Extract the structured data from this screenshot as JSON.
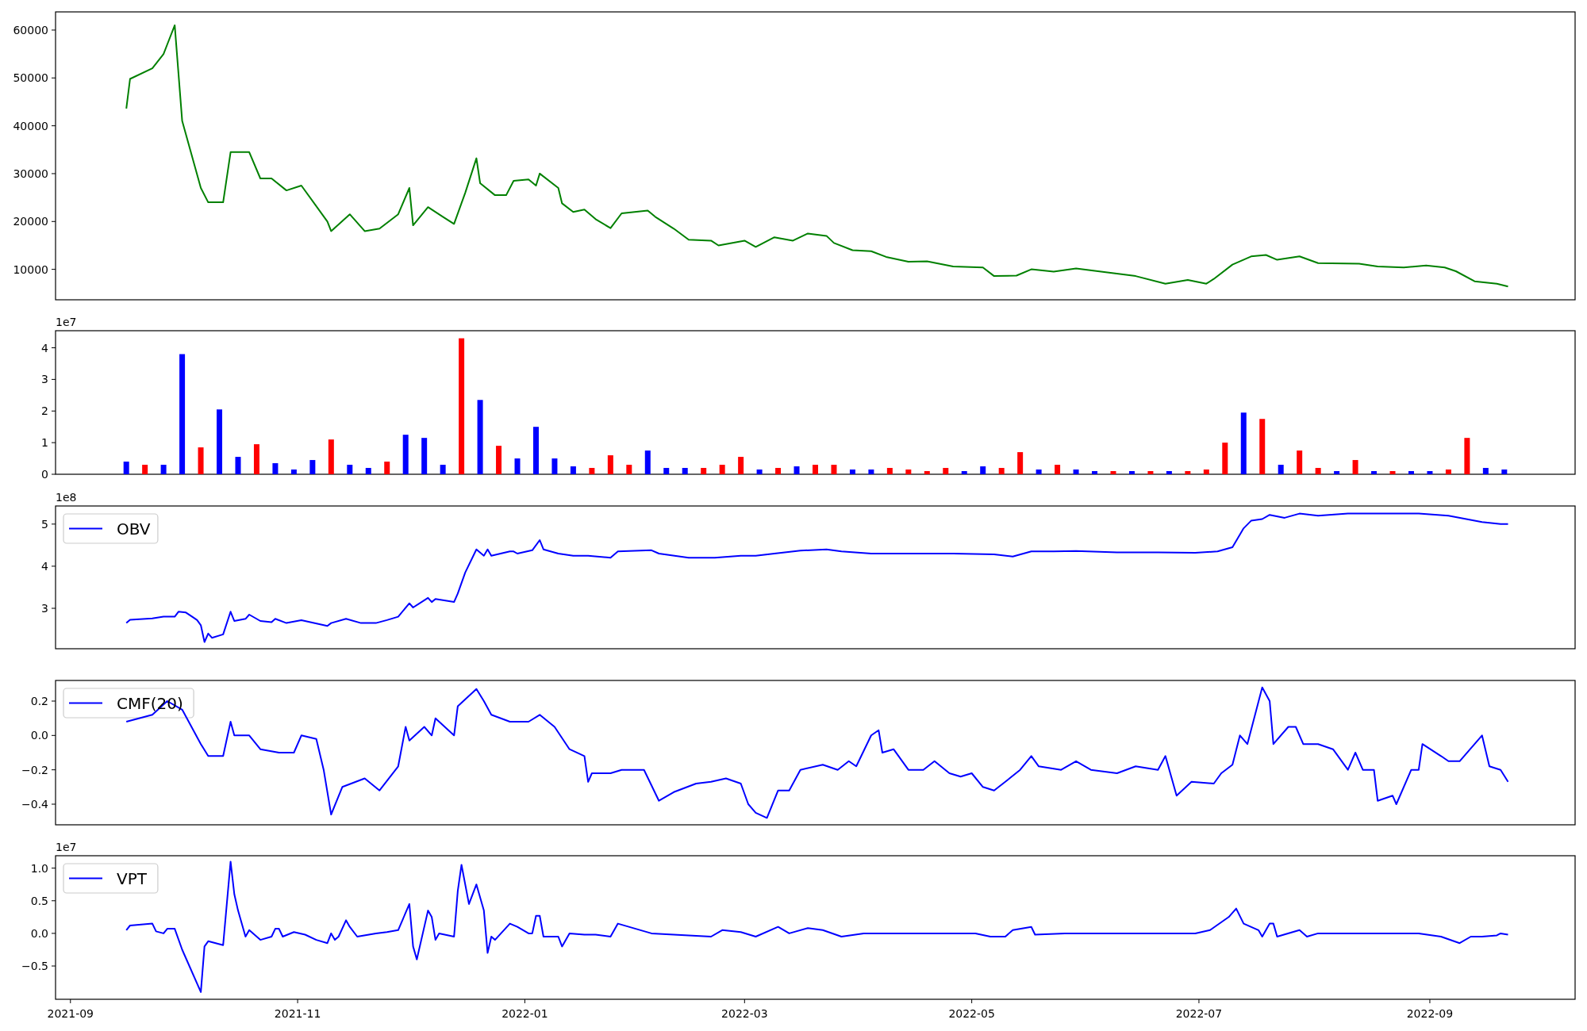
{
  "panels": [
    {
      "legend": false,
      "chart_data": {
        "type": "line",
        "xlim": [
          "2021-08-28",
          "2022-10-10"
        ],
        "ylim": [
          3640,
          63800
        ],
        "yticks": [
          10000,
          20000,
          30000,
          40000,
          50000,
          60000
        ],
        "x": [
          "2021-09-16",
          "2021-09-17",
          "2021-09-23",
          "2021-09-26",
          "2021-09-27",
          "2021-09-29",
          "2021-10-01",
          "2021-10-06",
          "2021-10-08",
          "2021-10-12",
          "2021-10-14",
          "2021-10-19",
          "2021-10-22",
          "2021-10-25",
          "2021-10-29",
          "2021-11-02",
          "2021-11-09",
          "2021-11-10",
          "2021-11-15",
          "2021-11-19",
          "2021-11-23",
          "2021-11-28",
          "2021-12-01",
          "2021-12-02",
          "2021-12-06",
          "2021-12-10",
          "2021-12-13",
          "2021-12-16",
          "2021-12-19",
          "2021-12-20",
          "2021-12-24",
          "2021-12-27",
          "2021-12-29",
          "2022-01-02",
          "2022-01-04",
          "2022-01-05",
          "2022-01-10",
          "2022-01-11",
          "2022-01-14",
          "2022-01-17",
          "2022-01-20",
          "2022-01-24",
          "2022-01-27",
          "2022-02-03",
          "2022-02-05",
          "2022-02-10",
          "2022-02-14",
          "2022-02-20",
          "2022-02-22",
          "2022-03-01",
          "2022-03-04",
          "2022-03-09",
          "2022-03-14",
          "2022-03-18",
          "2022-03-23",
          "2022-03-25",
          "2022-03-30",
          "2022-04-04",
          "2022-04-08",
          "2022-04-14",
          "2022-04-19",
          "2022-04-26",
          "2022-05-04",
          "2022-05-07",
          "2022-05-13",
          "2022-05-17",
          "2022-05-23",
          "2022-05-29",
          "2022-06-06",
          "2022-06-14",
          "2022-06-22",
          "2022-06-28",
          "2022-07-03",
          "2022-07-05",
          "2022-07-10",
          "2022-07-15",
          "2022-07-19",
          "2022-07-22",
          "2022-07-28",
          "2022-08-02",
          "2022-08-13",
          "2022-08-18",
          "2022-08-25",
          "2022-08-31",
          "2022-09-05",
          "2022-09-08",
          "2022-09-13",
          "2022-09-19",
          "2022-09-22"
        ],
        "series": [
          {
            "color": "#008000",
            "values": [
              43600,
              49800,
              52000,
              55000,
              57000,
              61000,
              41000,
              27000,
              24000,
              24000,
              34500,
              34500,
              29000,
              29000,
              26500,
              27500,
              20000,
              18000,
              21500,
              18000,
              18500,
              21500,
              27000,
              19200,
              23000,
              21000,
              19500,
              26000,
              33200,
              28000,
              25500,
              25500,
              28500,
              28800,
              27500,
              30000,
              27000,
              23800,
              22000,
              22500,
              20500,
              18600,
              21700,
              22300,
              21000,
              18500,
              16200,
              16000,
              15000,
              16000,
              14700,
              16700,
              16000,
              17500,
              17000,
              15500,
              14000,
              13800,
              12600,
              11600,
              11700,
              10600,
              10400,
              8600,
              8700,
              10000,
              9500,
              10200,
              9400,
              8600,
              7000,
              7800,
              7000,
              8000,
              11000,
              12700,
              13000,
              12000,
              12700,
              11300,
              11200,
              10600,
              10400,
              10800,
              10400,
              9600,
              7500,
              7000,
              6400
            ]
          }
        ]
      }
    },
    {
      "legend": false,
      "offset_label": "1e7",
      "chart_data": {
        "type": "bar",
        "xlim": [
          "2021-08-28",
          "2022-10-10"
        ],
        "ylim": [
          0,
          4.54
        ],
        "yticks": [
          {
            "value": 0,
            "label": "0"
          },
          {
            "value": 1,
            "label": "1"
          },
          {
            "value": 2,
            "label": "2"
          },
          {
            "value": 3,
            "label": "3"
          },
          {
            "value": 4,
            "label": "4"
          }
        ],
        "x": [
          "2021-09-16",
          "2021-09-21",
          "2021-09-26",
          "2021-10-01",
          "2021-10-06",
          "2021-10-11",
          "2021-10-16",
          "2021-10-21",
          "2021-10-26",
          "2021-10-31",
          "2021-11-05",
          "2021-11-10",
          "2021-11-15",
          "2021-11-20",
          "2021-11-25",
          "2021-11-30",
          "2021-12-05",
          "2021-12-10",
          "2021-12-15",
          "2021-12-20",
          "2021-12-25",
          "2021-12-30",
          "2022-01-04",
          "2022-01-09",
          "2022-01-14",
          "2022-01-19",
          "2022-01-24",
          "2022-01-29",
          "2022-02-03",
          "2022-02-08",
          "2022-02-13",
          "2022-02-18",
          "2022-02-23",
          "2022-02-28",
          "2022-03-05",
          "2022-03-10",
          "2022-03-15",
          "2022-03-20",
          "2022-03-25",
          "2022-03-30",
          "2022-04-04",
          "2022-04-09",
          "2022-04-14",
          "2022-04-19",
          "2022-04-24",
          "2022-04-29",
          "2022-05-04",
          "2022-05-09",
          "2022-05-14",
          "2022-05-19",
          "2022-05-24",
          "2022-05-29",
          "2022-06-03",
          "2022-06-08",
          "2022-06-13",
          "2022-06-18",
          "2022-06-23",
          "2022-06-28",
          "2022-07-03",
          "2022-07-08",
          "2022-07-13",
          "2022-07-18",
          "2022-07-23",
          "2022-07-28",
          "2022-08-02",
          "2022-08-07",
          "2022-08-12",
          "2022-08-17",
          "2022-08-22",
          "2022-08-27",
          "2022-09-01",
          "2022-09-06",
          "2022-09-11",
          "2022-09-16",
          "2022-09-21"
        ],
        "series": [
          {
            "color": "#ff0000",
            "values": [
              null,
              0.3,
              null,
              null,
              0.85,
              null,
              null,
              0.95,
              null,
              null,
              null,
              1.1,
              null,
              null,
              0.4,
              null,
              null,
              null,
              4.3,
              null,
              0.9,
              null,
              null,
              null,
              null,
              0.2,
              0.6,
              0.3,
              null,
              null,
              null,
              0.2,
              0.3,
              0.55,
              null,
              0.2,
              null,
              0.3,
              0.3,
              null,
              null,
              0.2,
              0.15,
              0.1,
              0.2,
              null,
              null,
              0.2,
              0.7,
              null,
              0.3,
              null,
              null,
              0.1,
              null,
              0.1,
              null,
              0.1,
              0.15,
              1.0,
              null,
              1.75,
              null,
              0.75,
              0.2,
              null,
              0.45,
              null,
              0.1,
              null,
              null,
              0.15,
              1.15,
              null,
              null
            ]
          },
          {
            "color": "#0000ff",
            "values": [
              0.4,
              null,
              0.3,
              3.8,
              null,
              2.05,
              0.55,
              null,
              0.35,
              0.15,
              0.45,
              null,
              0.3,
              0.2,
              null,
              1.25,
              1.15,
              0.3,
              null,
              2.35,
              null,
              0.5,
              1.5,
              0.5,
              0.25,
              null,
              null,
              null,
              0.75,
              0.2,
              0.2,
              null,
              null,
              null,
              0.15,
              null,
              0.25,
              null,
              null,
              0.15,
              0.15,
              null,
              null,
              null,
              null,
              0.1,
              0.25,
              null,
              null,
              0.15,
              null,
              0.15,
              0.1,
              null,
              0.1,
              null,
              0.1,
              null,
              null,
              null,
              1.95,
              null,
              0.3,
              null,
              null,
              0.1,
              null,
              0.1,
              null,
              0.1,
              0.1,
              null,
              null,
              0.2,
              0.15
            ]
          }
        ]
      }
    },
    {
      "legend": true,
      "offset_label": "1e8",
      "chart_data": {
        "type": "line",
        "xlim": [
          "2021-08-28",
          "2022-10-10"
        ],
        "ylim": [
          2.04,
          5.43
        ],
        "yticks": [
          3,
          4,
          5
        ],
        "x": [
          "2021-09-16",
          "2021-09-17",
          "2021-09-23",
          "2021-09-26",
          "2021-09-29",
          "2021-09-30",
          "2021-10-02",
          "2021-10-04",
          "2021-10-05",
          "2021-10-06",
          "2021-10-07",
          "2021-10-08",
          "2021-10-09",
          "2021-10-12",
          "2021-10-14",
          "2021-10-15",
          "2021-10-18",
          "2021-10-19",
          "2021-10-22",
          "2021-10-25",
          "2021-10-26",
          "2021-10-29",
          "2021-11-02",
          "2021-11-09",
          "2021-11-10",
          "2021-11-14",
          "2021-11-18",
          "2021-11-22",
          "2021-11-25",
          "2021-11-28",
          "2021-12-01",
          "2021-12-02",
          "2021-12-06",
          "2021-12-07",
          "2021-12-08",
          "2021-12-13",
          "2021-12-14",
          "2021-12-16",
          "2021-12-19",
          "2021-12-21",
          "2021-12-22",
          "2021-12-23",
          "2021-12-28",
          "2021-12-29",
          "2021-12-30",
          "2022-01-03",
          "2022-01-05",
          "2022-01-06",
          "2022-01-10",
          "2022-01-14",
          "2022-01-18",
          "2022-01-24",
          "2022-01-26",
          "2022-02-04",
          "2022-02-06",
          "2022-02-14",
          "2022-02-21",
          "2022-02-28",
          "2022-03-04",
          "2022-03-09",
          "2022-03-16",
          "2022-03-23",
          "2022-03-27",
          "2022-04-04",
          "2022-04-15",
          "2022-04-26",
          "2022-05-07",
          "2022-05-12",
          "2022-05-17",
          "2022-05-23",
          "2022-05-29",
          "2022-06-09",
          "2022-06-20",
          "2022-06-30",
          "2022-07-06",
          "2022-07-10",
          "2022-07-13",
          "2022-07-15",
          "2022-07-18",
          "2022-07-20",
          "2022-07-24",
          "2022-07-28",
          "2022-08-02",
          "2022-08-10",
          "2022-08-18",
          "2022-08-29",
          "2022-09-06",
          "2022-09-15",
          "2022-09-20",
          "2022-09-22"
        ],
        "series": [
          {
            "name": "OBV",
            "color": "#0000ff",
            "values": [
              2.65,
              2.73,
              2.76,
              2.8,
              2.8,
              2.92,
              2.9,
              2.78,
              2.72,
              2.6,
              2.2,
              2.4,
              2.3,
              2.38,
              2.92,
              2.7,
              2.75,
              2.85,
              2.7,
              2.67,
              2.75,
              2.65,
              2.72,
              2.58,
              2.65,
              2.75,
              2.65,
              2.65,
              2.72,
              2.8,
              3.12,
              3.02,
              3.25,
              3.15,
              3.22,
              3.15,
              3.35,
              3.85,
              4.4,
              4.25,
              4.4,
              4.25,
              4.35,
              4.35,
              4.3,
              4.38,
              4.62,
              4.4,
              4.3,
              4.25,
              4.25,
              4.2,
              4.35,
              4.38,
              4.3,
              4.2,
              4.2,
              4.25,
              4.25,
              4.3,
              4.37,
              4.4,
              4.35,
              4.3,
              4.3,
              4.3,
              4.28,
              4.23,
              4.35,
              4.35,
              4.36,
              4.33,
              4.33,
              4.32,
              4.35,
              4.45,
              4.9,
              5.08,
              5.12,
              5.22,
              5.15,
              5.25,
              5.2,
              5.25,
              5.25,
              5.25,
              5.2,
              5.05,
              5.0,
              5.0
            ]
          }
        ]
      }
    },
    {
      "legend": true,
      "chart_data": {
        "type": "line",
        "xlim": [
          "2021-08-28",
          "2022-10-10"
        ],
        "ylim": [
          -0.52,
          0.32
        ],
        "yticks": [
          {
            "value": 0.2,
            "label": "0.2"
          },
          {
            "value": 0,
            "label": "0.0"
          },
          {
            "value": -0.2,
            "label": "−0.2"
          },
          {
            "value": -0.4,
            "label": "−0.4"
          }
        ],
        "x": [
          "2021-09-16",
          "2021-09-23",
          "2021-09-27",
          "2021-10-01",
          "2021-10-06",
          "2021-10-08",
          "2021-10-12",
          "2021-10-14",
          "2021-10-15",
          "2021-10-19",
          "2021-10-22",
          "2021-10-27",
          "2021-10-31",
          "2021-11-02",
          "2021-11-06",
          "2021-11-08",
          "2021-11-10",
          "2021-11-13",
          "2021-11-19",
          "2021-11-23",
          "2021-11-28",
          "2021-11-30",
          "2021-12-01",
          "2021-12-05",
          "2021-12-07",
          "2021-12-08",
          "2021-12-13",
          "2021-12-14",
          "2021-12-19",
          "2021-12-21",
          "2021-12-23",
          "2021-12-28",
          "2022-01-02",
          "2022-01-05",
          "2022-01-09",
          "2022-01-13",
          "2022-01-17",
          "2022-01-18",
          "2022-01-19",
          "2022-01-24",
          "2022-01-27",
          "2022-02-02",
          "2022-02-06",
          "2022-02-10",
          "2022-02-16",
          "2022-02-20",
          "2022-02-24",
          "2022-02-28",
          "2022-03-02",
          "2022-03-04",
          "2022-03-07",
          "2022-03-10",
          "2022-03-13",
          "2022-03-16",
          "2022-03-22",
          "2022-03-26",
          "2022-03-29",
          "2022-03-31",
          "2022-04-04",
          "2022-04-06",
          "2022-04-07",
          "2022-04-10",
          "2022-04-14",
          "2022-04-18",
          "2022-04-21",
          "2022-04-25",
          "2022-04-28",
          "2022-05-01",
          "2022-05-04",
          "2022-05-07",
          "2022-05-10",
          "2022-05-14",
          "2022-05-17",
          "2022-05-19",
          "2022-05-25",
          "2022-05-29",
          "2022-06-02",
          "2022-06-09",
          "2022-06-14",
          "2022-06-20",
          "2022-06-22",
          "2022-06-25",
          "2022-06-29",
          "2022-07-05",
          "2022-07-07",
          "2022-07-10",
          "2022-07-12",
          "2022-07-14",
          "2022-07-18",
          "2022-07-20",
          "2022-07-21",
          "2022-07-25",
          "2022-07-27",
          "2022-07-29",
          "2022-08-02",
          "2022-08-06",
          "2022-08-10",
          "2022-08-12",
          "2022-08-14",
          "2022-08-17",
          "2022-08-18",
          "2022-08-22",
          "2022-08-23",
          "2022-08-27",
          "2022-08-29",
          "2022-08-30",
          "2022-09-04",
          "2022-09-06",
          "2022-09-09",
          "2022-09-15",
          "2022-09-17",
          "2022-09-20",
          "2022-09-22"
        ],
        "series": [
          {
            "name": "CMF(20)",
            "color": "#0000ff",
            "values": [
              0.08,
              0.12,
              0.2,
              0.15,
              -0.05,
              -0.12,
              -0.12,
              0.08,
              0.0,
              0.0,
              -0.08,
              -0.1,
              -0.1,
              0.0,
              -0.02,
              -0.2,
              -0.46,
              -0.3,
              -0.25,
              -0.32,
              -0.18,
              0.05,
              -0.03,
              0.05,
              0.0,
              0.1,
              0.0,
              0.17,
              0.27,
              0.2,
              0.12,
              0.08,
              0.08,
              0.12,
              0.05,
              -0.08,
              -0.12,
              -0.27,
              -0.22,
              -0.22,
              -0.2,
              -0.2,
              -0.38,
              -0.33,
              -0.28,
              -0.27,
              -0.25,
              -0.28,
              -0.4,
              -0.45,
              -0.48,
              -0.32,
              -0.32,
              -0.2,
              -0.17,
              -0.2,
              -0.15,
              -0.18,
              0.0,
              0.03,
              -0.1,
              -0.08,
              -0.2,
              -0.2,
              -0.15,
              -0.22,
              -0.24,
              -0.22,
              -0.3,
              -0.32,
              -0.27,
              -0.2,
              -0.12,
              -0.18,
              -0.2,
              -0.15,
              -0.2,
              -0.22,
              -0.18,
              -0.2,
              -0.12,
              -0.35,
              -0.27,
              -0.28,
              -0.22,
              -0.17,
              0.0,
              -0.05,
              0.28,
              0.2,
              -0.05,
              0.05,
              0.05,
              -0.05,
              -0.05,
              -0.08,
              -0.2,
              -0.1,
              -0.2,
              -0.2,
              -0.38,
              -0.35,
              -0.4,
              -0.2,
              -0.2,
              -0.05,
              -0.12,
              -0.15,
              -0.15,
              0.0,
              -0.18,
              -0.2,
              -0.27
            ]
          }
        ]
      }
    },
    {
      "legend": true,
      "offset_label": "1e7",
      "chart_data": {
        "type": "line",
        "xlim": [
          "2021-08-28",
          "2022-10-10"
        ],
        "ylim": [
          -1.01,
          1.19
        ],
        "yticks": [
          {
            "value": 1,
            "label": "1.0"
          },
          {
            "value": 0.5,
            "label": "0.5"
          },
          {
            "value": 0,
            "label": "0.0"
          },
          {
            "value": -0.5,
            "label": "−0.5"
          }
        ],
        "xticks": [
          {
            "value": "2021-09-01",
            "label": "2021-09"
          },
          {
            "value": "2021-11-01",
            "label": "2021-11"
          },
          {
            "value": "2022-01-01",
            "label": "2022-01"
          },
          {
            "value": "2022-03-01",
            "label": "2022-03"
          },
          {
            "value": "2022-05-01",
            "label": "2022-05"
          },
          {
            "value": "2022-07-01",
            "label": "2022-07"
          },
          {
            "value": "2022-09-01",
            "label": "2022-09"
          }
        ],
        "x": [
          "2021-09-16",
          "2021-09-17",
          "2021-09-23",
          "2021-09-24",
          "2021-09-26",
          "2021-09-27",
          "2021-09-29",
          "2021-10-01",
          "2021-10-06",
          "2021-10-07",
          "2021-10-08",
          "2021-10-12",
          "2021-10-14",
          "2021-10-15",
          "2021-10-16",
          "2021-10-18",
          "2021-10-19",
          "2021-10-22",
          "2021-10-25",
          "2021-10-26",
          "2021-10-27",
          "2021-10-28",
          "2021-10-31",
          "2021-11-03",
          "2021-11-06",
          "2021-11-09",
          "2021-11-10",
          "2021-11-11",
          "2021-11-12",
          "2021-11-14",
          "2021-11-15",
          "2021-11-17",
          "2021-11-22",
          "2021-11-25",
          "2021-11-28",
          "2021-12-01",
          "2021-12-02",
          "2021-12-03",
          "2021-12-06",
          "2021-12-07",
          "2021-12-08",
          "2021-12-09",
          "2021-12-13",
          "2021-12-14",
          "2021-12-15",
          "2021-12-17",
          "2021-12-19",
          "2021-12-21",
          "2021-12-22",
          "2021-12-23",
          "2021-12-24",
          "2021-12-28",
          "2021-12-30",
          "2022-01-02",
          "2022-01-03",
          "2022-01-04",
          "2022-01-05",
          "2022-01-06",
          "2022-01-10",
          "2022-01-11",
          "2022-01-13",
          "2022-01-17",
          "2022-01-20",
          "2022-01-24",
          "2022-01-26",
          "2022-02-04",
          "2022-02-20",
          "2022-02-23",
          "2022-02-28",
          "2022-03-04",
          "2022-03-10",
          "2022-03-13",
          "2022-03-18",
          "2022-03-22",
          "2022-03-27",
          "2022-04-02",
          "2022-04-15",
          "2022-05-02",
          "2022-05-06",
          "2022-05-10",
          "2022-05-12",
          "2022-05-17",
          "2022-05-18",
          "2022-05-26",
          "2022-06-09",
          "2022-06-22",
          "2022-06-30",
          "2022-07-04",
          "2022-07-09",
          "2022-07-11",
          "2022-07-13",
          "2022-07-17",
          "2022-07-18",
          "2022-07-20",
          "2022-07-21",
          "2022-07-22",
          "2022-07-28",
          "2022-07-30",
          "2022-08-02",
          "2022-08-16",
          "2022-08-29",
          "2022-09-04",
          "2022-09-09",
          "2022-09-12",
          "2022-09-15",
          "2022-09-19",
          "2022-09-20",
          "2022-09-22"
        ],
        "series": [
          {
            "name": "VPT",
            "color": "#0000ff",
            "values": [
              0.05,
              0.12,
              0.15,
              0.03,
              0,
              0.07,
              0.07,
              -0.25,
              -0.9,
              -0.2,
              -0.12,
              -0.18,
              1.1,
              0.6,
              0.35,
              -0.05,
              0.05,
              -0.1,
              -0.05,
              0.07,
              0.07,
              -0.05,
              0.02,
              -0.02,
              -0.1,
              -0.15,
              0,
              -0.1,
              -0.05,
              0.2,
              0.1,
              -0.05,
              0,
              0.02,
              0.05,
              0.45,
              -0.2,
              -0.4,
              0.35,
              0.25,
              -0.1,
              0,
              -0.05,
              0.65,
              1.05,
              0.45,
              0.75,
              0.35,
              -0.3,
              -0.05,
              -0.1,
              0.15,
              0.1,
              0,
              0,
              0.27,
              0.27,
              -0.05,
              -0.05,
              -0.2,
              0,
              -0.02,
              -0.02,
              -0.05,
              0.15,
              0,
              -0.05,
              0.05,
              0.02,
              -0.05,
              0.1,
              0,
              0.08,
              0.05,
              -0.05,
              0,
              0,
              0,
              -0.05,
              -0.05,
              0.05,
              0.1,
              -0.02,
              0,
              0,
              0,
              0,
              0.05,
              0.25,
              0.38,
              0.15,
              0.05,
              -0.05,
              0.15,
              0.15,
              -0.05,
              0.05,
              -0.05,
              0,
              0,
              0,
              -0.05,
              -0.15,
              -0.05,
              -0.05,
              -0.03,
              0,
              -0.02
            ]
          }
        ]
      }
    }
  ]
}
